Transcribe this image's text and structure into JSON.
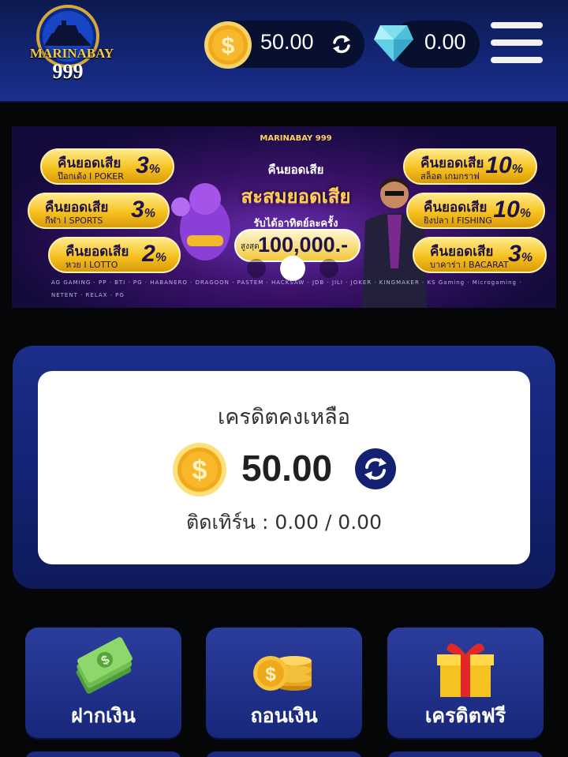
{
  "header": {
    "logo_text": "MARINABAY",
    "logo_number": "999",
    "coin_balance": "50.00",
    "gem_balance": "0.00"
  },
  "banner": {
    "logo_text": "MARINABAY",
    "logo_number": "999",
    "headline": "คืนยอดเสีย",
    "title": "สะสมยอดเสีย",
    "subtitle": "รับได้อาทิตย์ละครั้ง",
    "max_label": "สูงสุด",
    "max_amount": "100,000.-",
    "promos_left": [
      {
        "title": "คืนยอดเสีย",
        "sub": "ป๊อกเด้ง I POKER",
        "pct": "3",
        "unit": "%"
      },
      {
        "title": "คืนยอดเสีย",
        "sub": "กีฬา I SPORTS",
        "pct": "3",
        "unit": "%"
      },
      {
        "title": "คืนยอดเสีย",
        "sub": "หวย I LOTTO",
        "pct": "2",
        "unit": "%"
      }
    ],
    "promos_right": [
      {
        "title": "คืนยอดเสีย",
        "sub": "สล็อต เกมกราฟ",
        "pct": "10",
        "unit": "%"
      },
      {
        "title": "คืนยอดเสีย",
        "sub": "ยิงปลา I FISHING",
        "pct": "10",
        "unit": "%"
      },
      {
        "title": "คืนยอดเสีย",
        "sub": "บาคาร่า I BACARAT",
        "pct": "3",
        "unit": "%"
      }
    ],
    "providers": "AG GAMING · PP · BTI · PG · HABANERO · DRAGOON · PASTEM · HACKSAW · JDB · JILI · JOKER · KINGMAKER · KS Gaming · Microgaming · NETENT · RELAX · PG"
  },
  "credit": {
    "title": "เครดิตคงเหลือ",
    "amount": "50.00",
    "turnover_label": "ติดเทิร์น : 0.00 / 0.00"
  },
  "actions": [
    {
      "label": "ฝากเงิน",
      "icon": "cash-icon"
    },
    {
      "label": "ถอนเงิน",
      "icon": "coins-icon"
    },
    {
      "label": "เครดิตฟรี",
      "icon": "gift-icon"
    }
  ],
  "colors": {
    "header_bg": "#132575",
    "accent_gold": "#f6c21f",
    "panel_bg": "#1c2e8a",
    "refresh_bg": "#132170"
  }
}
